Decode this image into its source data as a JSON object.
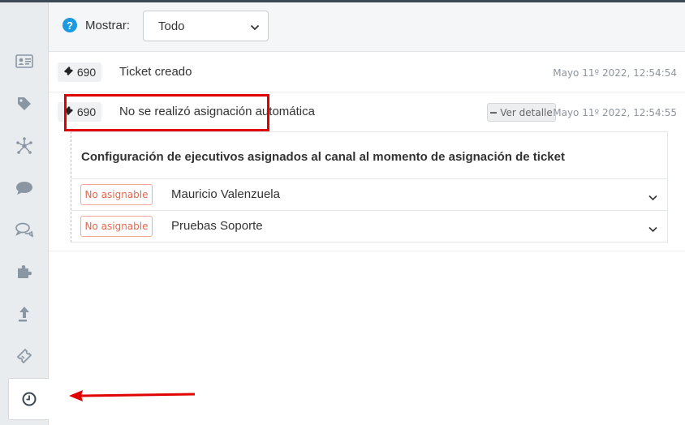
{
  "sidebar": {
    "items": [
      {
        "icon": "contact-card-icon"
      },
      {
        "icon": "tag-icon"
      },
      {
        "icon": "network-icon"
      },
      {
        "icon": "chat-bubble-icon"
      },
      {
        "icon": "conversations-icon"
      },
      {
        "icon": "puzzle-icon"
      },
      {
        "icon": "upload-arrow-icon"
      },
      {
        "icon": "ticket-icon"
      },
      {
        "icon": "clock-history-icon",
        "active": true
      }
    ]
  },
  "filter": {
    "label": "Mostrar:",
    "selected": "Todo"
  },
  "events": [
    {
      "ticket": "690",
      "text": "Ticket creado",
      "timestamp": "Mayo 11º 2022, 12:54:54"
    },
    {
      "ticket": "690",
      "text": "No se realizó asignación automática",
      "detail_button": "Ver detalle",
      "timestamp": "Mayo 11º 2022, 12:54:55"
    }
  ],
  "detail": {
    "title": "Configuración de ejecutivos asignados al canal al momento de asignación de ticket",
    "executives": [
      {
        "status": "No asignable",
        "name": "Mauricio Valenzuela"
      },
      {
        "status": "No asignable",
        "name": "Pruebas Soporte"
      }
    ]
  },
  "colors": {
    "accent_blue": "#1b9ae0",
    "highlight_red": "#e00000",
    "badge_orange": "#e4684f"
  }
}
